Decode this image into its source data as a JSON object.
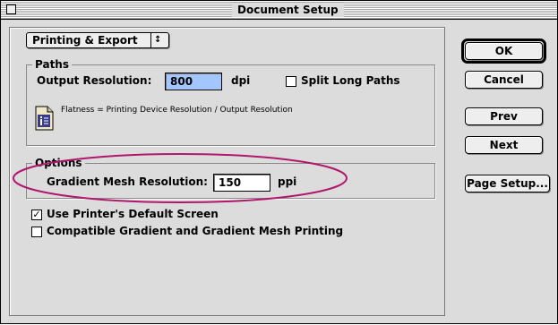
{
  "window": {
    "title": "Document Setup"
  },
  "section_popup": {
    "label": "Printing & Export",
    "arrows": "⬍"
  },
  "paths": {
    "title": "Paths",
    "output_resolution_label": "Output Resolution:",
    "output_resolution_value": "800",
    "output_resolution_unit": "dpi",
    "split_long_paths_label": "Split Long Paths",
    "split_long_paths_checked": false,
    "flatness_note": "Flatness = Printing Device Resolution / Output Resolution",
    "note_icon": "document-info-icon"
  },
  "options": {
    "title": "Options",
    "gradient_mesh_label": "Gradient Mesh Resolution:",
    "gradient_mesh_value": "150",
    "gradient_mesh_unit": "ppi",
    "use_printer_screen_label": "Use Printer's Default Screen",
    "use_printer_screen_checked": true,
    "compatible_gradient_label": "Compatible Gradient and Gradient Mesh Printing",
    "compatible_gradient_checked": false
  },
  "buttons": {
    "ok": "OK",
    "cancel": "Cancel",
    "prev": "Prev",
    "next": "Next",
    "page_setup": "Page Setup..."
  },
  "colors": {
    "selected_field": "#a4c6ff",
    "annotation_ellipse": "#b0176e"
  }
}
